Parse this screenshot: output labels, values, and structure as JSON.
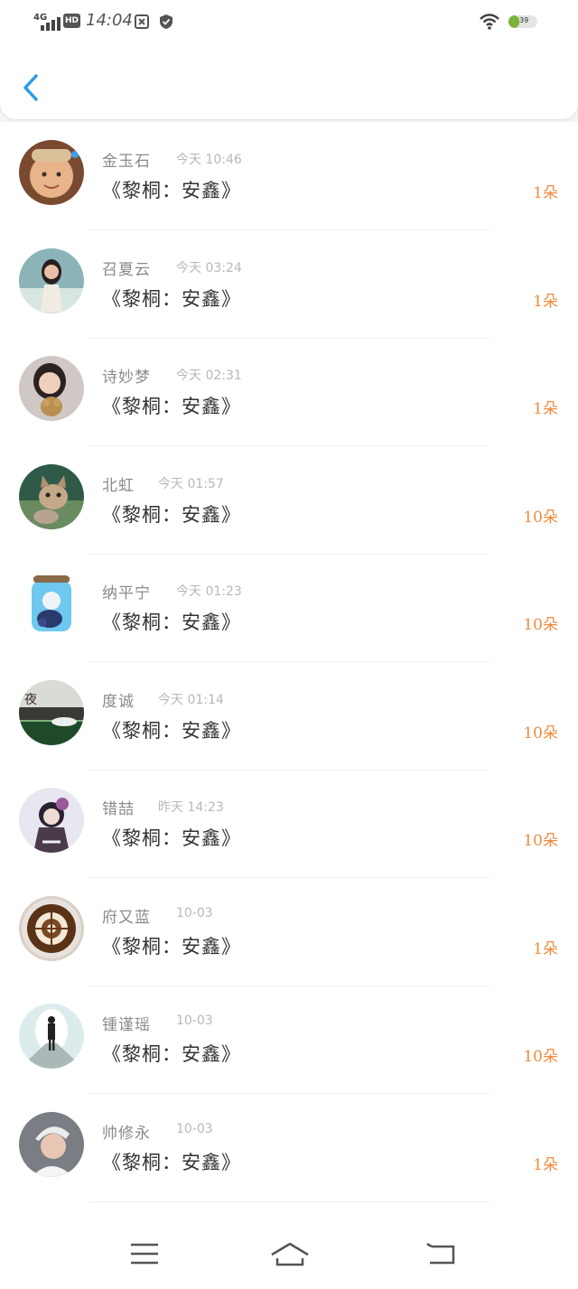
{
  "status_bar": {
    "network": "4G",
    "hd_badge": "HD",
    "time": "14:04",
    "battery": "39",
    "battery_level": 0.39
  },
  "header": {
    "back_icon": "chevron-left-icon",
    "accent_color": "#2b9be8"
  },
  "accent_color": "#f08a3c",
  "rows": [
    {
      "name": "金玉石",
      "time": "今天 10:46",
      "book": "《黎桐：安鑫》",
      "count": "1朵",
      "avatar": "person-avatar"
    },
    {
      "name": "召夏云",
      "time": "今天 03:24",
      "book": "《黎桐：安鑫》",
      "count": "1朵",
      "avatar": "girl-avatar"
    },
    {
      "name": "诗妙梦",
      "time": "今天 02:31",
      "book": "《黎桐：安鑫》",
      "count": "1朵",
      "avatar": "child-avatar"
    },
    {
      "name": "北虹",
      "time": "今天 01:57",
      "book": "《黎桐：安鑫》",
      "count": "10朵",
      "avatar": "cat-avatar"
    },
    {
      "name": "纳平宁",
      "time": "今天 01:23",
      "book": "《黎桐：安鑫》",
      "count": "10朵",
      "avatar": "jar-avatar"
    },
    {
      "name": "度诚",
      "time": "今天 01:14",
      "book": "《黎桐：安鑫》",
      "count": "10朵",
      "avatar": "landscape-avatar"
    },
    {
      "name": "错喆",
      "time": "昨天 14:23",
      "book": "《黎桐：安鑫》",
      "count": "10朵",
      "avatar": "doll-avatar"
    },
    {
      "name": "府又蓝",
      "time": "10-03",
      "book": "《黎桐：安鑫》",
      "count": "1朵",
      "avatar": "coffee-avatar"
    },
    {
      "name": "锺谨瑶",
      "time": "10-03",
      "book": "《黎桐：安鑫》",
      "count": "10朵",
      "avatar": "tunnel-avatar"
    },
    {
      "name": "帅修永",
      "time": "10-03",
      "book": "《黎桐：安鑫》",
      "count": "1朵",
      "avatar": "man-avatar"
    }
  ],
  "nav": {
    "menu_icon": "menu-icon",
    "home_icon": "home-icon",
    "back_icon": "return-icon"
  }
}
